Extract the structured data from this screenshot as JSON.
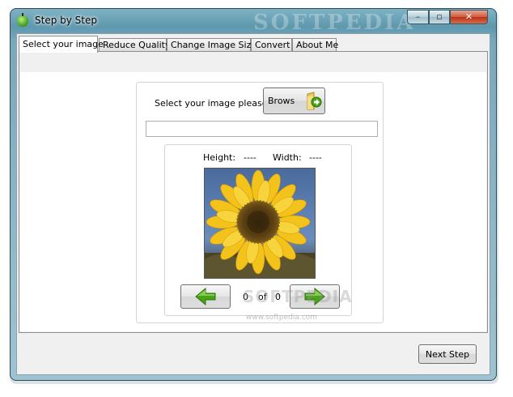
{
  "window": {
    "title": "Step by Step",
    "watermark": "SOFTPEDIA",
    "controls": {
      "minimize": "–",
      "maximize": "▫",
      "close": "✕"
    }
  },
  "tabs": [
    {
      "label": "Select your image",
      "active": true
    },
    {
      "label": "Reduce Quality",
      "active": false
    },
    {
      "label": "Change Image Size",
      "active": false
    },
    {
      "label": "Convert",
      "active": false
    },
    {
      "label": "About Me",
      "active": false
    }
  ],
  "select": {
    "prompt": "Select your image please:",
    "browse_label": "Brows",
    "browse_icon": "folder-arrow-icon",
    "path_value": ""
  },
  "preview": {
    "height_label": "Height:",
    "height_value": "----",
    "width_label": "Width:",
    "width_value": "----",
    "current": "0",
    "of_label": "of",
    "total": "0",
    "watermark": "SOFTPEDIA",
    "watermark_url": "www.softpedia.com"
  },
  "footer": {
    "next_step_label": "Next Step"
  },
  "colors": {
    "arrow_green": "#49a316",
    "title_bar": "#6fa3b6",
    "close_red": "#c8452a"
  }
}
